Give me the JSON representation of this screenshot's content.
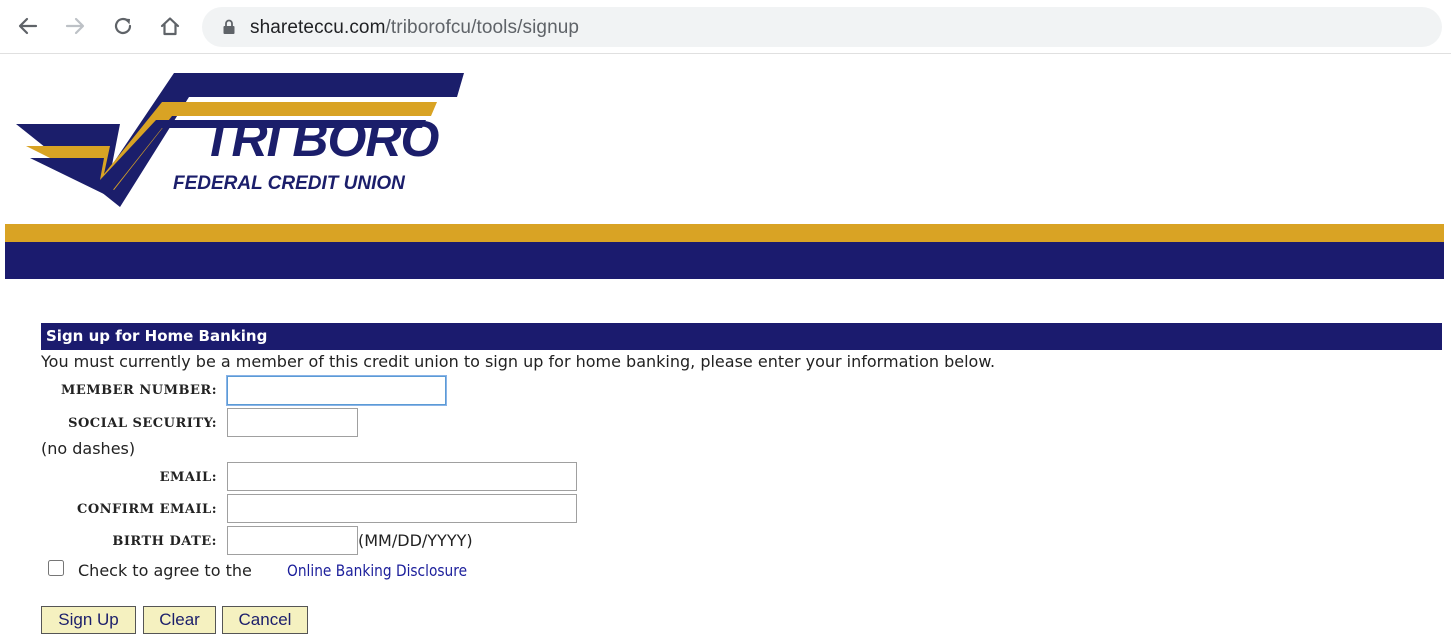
{
  "browser": {
    "url_domain": "shareteccu.com",
    "url_path": "/triborofcu/tools/signup"
  },
  "logo": {
    "title": "TRI BORO",
    "subtitle": "FEDERAL CREDIT UNION"
  },
  "colors": {
    "navy": "#1b1b6e",
    "gold": "#d9a324",
    "button_bg": "#f5f1c0",
    "link": "#1b1e9b"
  },
  "form": {
    "header": "Sign up for Home Banking",
    "intro": "You must currently be a member of this credit union to sign up for home banking, please enter your information below.",
    "member_number_label": "MEMBER NUMBER:",
    "member_number_value": "",
    "social_security_label": "SOCIAL SECURITY:",
    "social_security_value": "",
    "no_dashes_hint": "(no dashes)",
    "email_label": "EMAIL:",
    "email_value": "",
    "confirm_email_label": "CONFIRM EMAIL:",
    "confirm_email_value": "",
    "birth_date_label": "BIRTH DATE:",
    "birth_date_value": "",
    "birth_date_hint": "(MM/DD/YYYY)",
    "agree_text": "Check to agree to the",
    "agree_checked": false,
    "disclosure_link": "Online Banking Disclosure",
    "signup_button": "Sign Up",
    "clear_button": "Clear",
    "cancel_button": "Cancel"
  }
}
